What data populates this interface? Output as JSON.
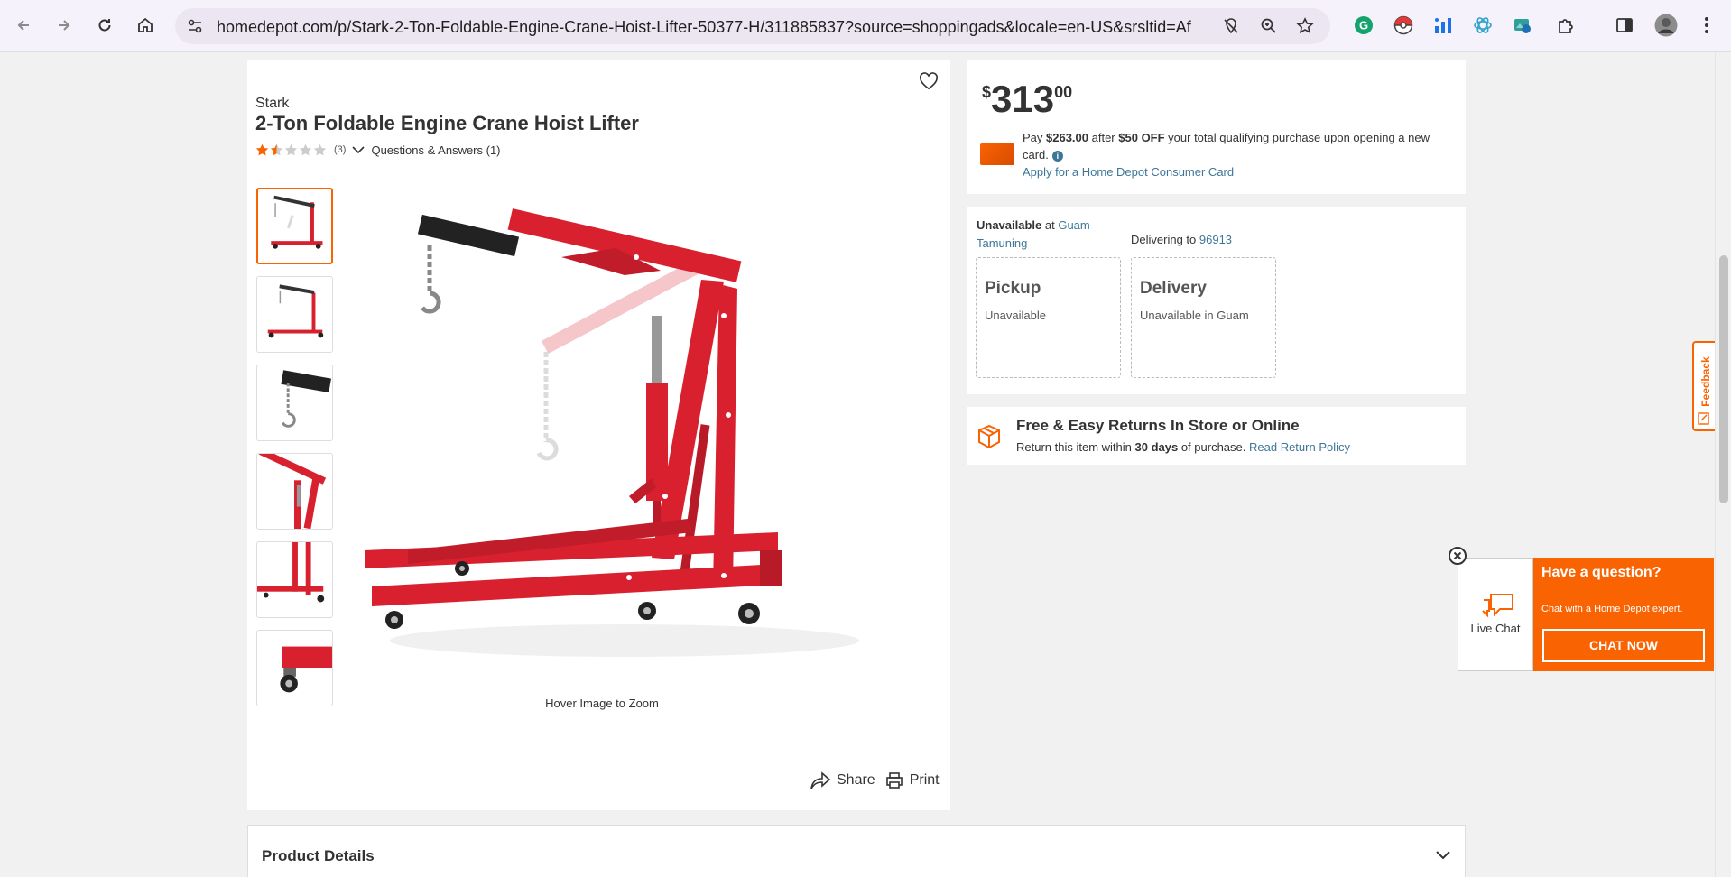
{
  "browser": {
    "url": "homedepot.com/p/Stark-2-Ton-Foldable-Engine-Crane-Hoist-Lifter-50377-H/311885837?source=shoppingads&locale=en-US&srsltid=AfmB..."
  },
  "product": {
    "brand": "Stark",
    "title": "2-Ton Foldable Engine Crane Hoist Lifter",
    "rating_stars": 1.5,
    "review_count": "(3)",
    "qa_link": "Questions & Answers (1)",
    "hover_hint": "Hover Image to Zoom",
    "share_label": "Share",
    "print_label": "Print"
  },
  "price": {
    "dollar_sign": "$",
    "whole": "313",
    "cents": "00",
    "promo_pay": "Pay ",
    "promo_amount": "$263.00",
    "promo_after": " after ",
    "promo_off": "$50 OFF",
    "promo_rest": " your total qualifying purchase upon opening a new card.",
    "apply_link": "Apply for a Home Depot Consumer Card"
  },
  "fulfillment": {
    "unavailable_label": "Unavailable",
    "at_text": " at ",
    "store_name": "Guam - Tamuning",
    "delivering_label": "Delivering to ",
    "zip": "96913",
    "pickup_title": "Pickup",
    "pickup_status": "Unavailable",
    "delivery_title": "Delivery",
    "delivery_status": "Unavailable in Guam"
  },
  "returns": {
    "title": "Free & Easy Returns In Store or Online",
    "text_before": "Return this item within ",
    "days": "30",
    "days_label": " days",
    "text_after": " of purchase. ",
    "policy_link": "Read Return Policy"
  },
  "details": {
    "title": "Product Details"
  },
  "feedback": {
    "label": "Feedback"
  },
  "chat": {
    "live_chat_label": "Live Chat",
    "question": "Have a question?",
    "subtitle": "Chat with a Home Depot expert.",
    "button": "CHAT NOW"
  },
  "colors": {
    "accent_orange": "#f96302",
    "link_blue": "#3e7697",
    "crane_red": "#d8202f"
  }
}
